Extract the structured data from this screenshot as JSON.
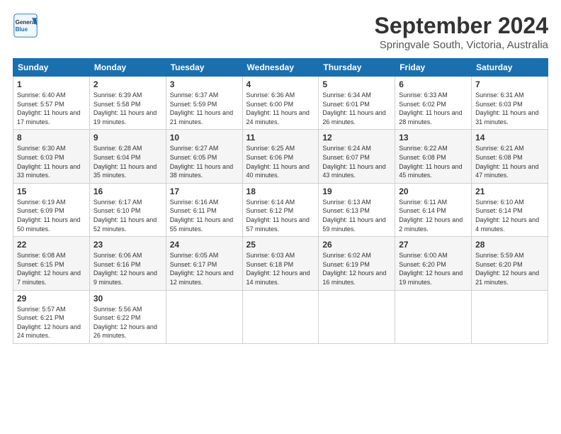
{
  "logo": {
    "line1": "General",
    "line2": "Blue"
  },
  "title": "September 2024",
  "subtitle": "Springvale South, Victoria, Australia",
  "columns": [
    "Sunday",
    "Monday",
    "Tuesday",
    "Wednesday",
    "Thursday",
    "Friday",
    "Saturday"
  ],
  "weeks": [
    [
      {
        "day": "1",
        "sunrise": "6:40 AM",
        "sunset": "5:57 PM",
        "daylight": "11 hours and 17 minutes."
      },
      {
        "day": "2",
        "sunrise": "6:39 AM",
        "sunset": "5:58 PM",
        "daylight": "11 hours and 19 minutes."
      },
      {
        "day": "3",
        "sunrise": "6:37 AM",
        "sunset": "5:59 PM",
        "daylight": "11 hours and 21 minutes."
      },
      {
        "day": "4",
        "sunrise": "6:36 AM",
        "sunset": "6:00 PM",
        "daylight": "11 hours and 24 minutes."
      },
      {
        "day": "5",
        "sunrise": "6:34 AM",
        "sunset": "6:01 PM",
        "daylight": "11 hours and 26 minutes."
      },
      {
        "day": "6",
        "sunrise": "6:33 AM",
        "sunset": "6:02 PM",
        "daylight": "11 hours and 28 minutes."
      },
      {
        "day": "7",
        "sunrise": "6:31 AM",
        "sunset": "6:03 PM",
        "daylight": "11 hours and 31 minutes."
      }
    ],
    [
      {
        "day": "8",
        "sunrise": "6:30 AM",
        "sunset": "6:03 PM",
        "daylight": "11 hours and 33 minutes."
      },
      {
        "day": "9",
        "sunrise": "6:28 AM",
        "sunset": "6:04 PM",
        "daylight": "11 hours and 35 minutes."
      },
      {
        "day": "10",
        "sunrise": "6:27 AM",
        "sunset": "6:05 PM",
        "daylight": "11 hours and 38 minutes."
      },
      {
        "day": "11",
        "sunrise": "6:25 AM",
        "sunset": "6:06 PM",
        "daylight": "11 hours and 40 minutes."
      },
      {
        "day": "12",
        "sunrise": "6:24 AM",
        "sunset": "6:07 PM",
        "daylight": "11 hours and 43 minutes."
      },
      {
        "day": "13",
        "sunrise": "6:22 AM",
        "sunset": "6:08 PM",
        "daylight": "11 hours and 45 minutes."
      },
      {
        "day": "14",
        "sunrise": "6:21 AM",
        "sunset": "6:08 PM",
        "daylight": "11 hours and 47 minutes."
      }
    ],
    [
      {
        "day": "15",
        "sunrise": "6:19 AM",
        "sunset": "6:09 PM",
        "daylight": "11 hours and 50 minutes."
      },
      {
        "day": "16",
        "sunrise": "6:17 AM",
        "sunset": "6:10 PM",
        "daylight": "11 hours and 52 minutes."
      },
      {
        "day": "17",
        "sunrise": "6:16 AM",
        "sunset": "6:11 PM",
        "daylight": "11 hours and 55 minutes."
      },
      {
        "day": "18",
        "sunrise": "6:14 AM",
        "sunset": "6:12 PM",
        "daylight": "11 hours and 57 minutes."
      },
      {
        "day": "19",
        "sunrise": "6:13 AM",
        "sunset": "6:13 PM",
        "daylight": "11 hours and 59 minutes."
      },
      {
        "day": "20",
        "sunrise": "6:11 AM",
        "sunset": "6:14 PM",
        "daylight": "12 hours and 2 minutes."
      },
      {
        "day": "21",
        "sunrise": "6:10 AM",
        "sunset": "6:14 PM",
        "daylight": "12 hours and 4 minutes."
      }
    ],
    [
      {
        "day": "22",
        "sunrise": "6:08 AM",
        "sunset": "6:15 PM",
        "daylight": "12 hours and 7 minutes."
      },
      {
        "day": "23",
        "sunrise": "6:06 AM",
        "sunset": "6:16 PM",
        "daylight": "12 hours and 9 minutes."
      },
      {
        "day": "24",
        "sunrise": "6:05 AM",
        "sunset": "6:17 PM",
        "daylight": "12 hours and 12 minutes."
      },
      {
        "day": "25",
        "sunrise": "6:03 AM",
        "sunset": "6:18 PM",
        "daylight": "12 hours and 14 minutes."
      },
      {
        "day": "26",
        "sunrise": "6:02 AM",
        "sunset": "6:19 PM",
        "daylight": "12 hours and 16 minutes."
      },
      {
        "day": "27",
        "sunrise": "6:00 AM",
        "sunset": "6:20 PM",
        "daylight": "12 hours and 19 minutes."
      },
      {
        "day": "28",
        "sunrise": "5:59 AM",
        "sunset": "6:20 PM",
        "daylight": "12 hours and 21 minutes."
      }
    ],
    [
      {
        "day": "29",
        "sunrise": "5:57 AM",
        "sunset": "6:21 PM",
        "daylight": "12 hours and 24 minutes."
      },
      {
        "day": "30",
        "sunrise": "5:56 AM",
        "sunset": "6:22 PM",
        "daylight": "12 hours and 26 minutes."
      },
      null,
      null,
      null,
      null,
      null
    ]
  ],
  "labels": {
    "sunrise": "Sunrise: ",
    "sunset": "Sunset: ",
    "daylight": "Daylight: "
  }
}
